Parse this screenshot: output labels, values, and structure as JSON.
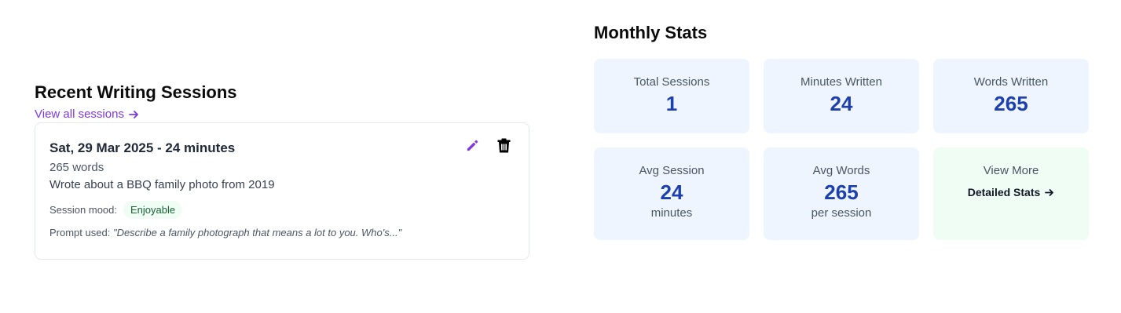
{
  "recent": {
    "title": "Recent Writing Sessions",
    "view_all_label": "View all sessions",
    "view_all_icon": "arrow-right-icon",
    "session": {
      "title": "Sat, 29 Mar 2025 - 24 minutes",
      "words": "265 words",
      "description": "Wrote about a BBQ family photo from 2019",
      "mood_label": "Session mood:",
      "mood_value": "Enjoyable",
      "prompt_label": "Prompt used:",
      "prompt_text": "\"Describe a family photograph that means a lot to you. Who's...\"",
      "edit_icon": "pencil-icon",
      "delete_icon": "trash-icon"
    }
  },
  "stats": {
    "title": "Monthly Stats",
    "tiles": [
      {
        "label": "Total Sessions",
        "value": "1"
      },
      {
        "label": "Minutes Written",
        "value": "24"
      },
      {
        "label": "Words Written",
        "value": "265"
      },
      {
        "label": "Avg Session",
        "value": "24",
        "sub": "minutes"
      },
      {
        "label": "Avg Words",
        "value": "265",
        "sub": "per session"
      },
      {
        "label": "View More",
        "link": "Detailed Stats",
        "icon": "arrow-right-icon"
      }
    ]
  },
  "colors": {
    "accent_purple": "#7e3ae0",
    "stat_value_blue": "#1e40af",
    "stat_tile_bg": "#eef5ff",
    "more_tile_bg": "#f0fdf4",
    "mood_badge_text": "#166534"
  }
}
